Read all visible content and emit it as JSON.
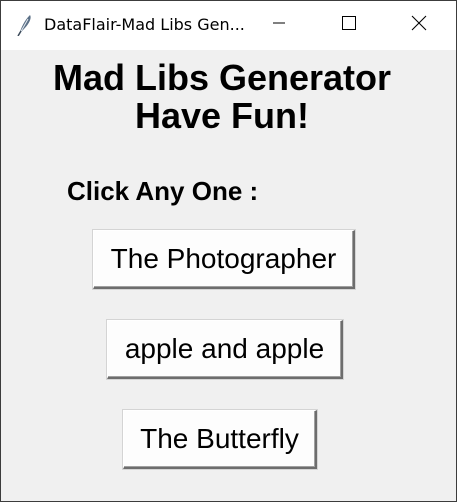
{
  "window": {
    "title": "DataFlair-Mad Libs Gen...",
    "icon": "feather-icon",
    "controls": {
      "minimize_icon": "minimize-icon",
      "maximize_icon": "maximize-icon",
      "close_icon": "close-icon"
    }
  },
  "main": {
    "heading_line1": "Mad Libs Generator",
    "heading_line2": "Have Fun!",
    "prompt": "Click Any One :",
    "buttons": [
      {
        "label": "The Photographer"
      },
      {
        "label": "apple and apple"
      },
      {
        "label": "The Butterfly"
      }
    ]
  },
  "colors": {
    "background": "#f0f0f0",
    "titlebar": "#ffffff",
    "button_face": "#fdfdfd",
    "text": "#000000"
  }
}
